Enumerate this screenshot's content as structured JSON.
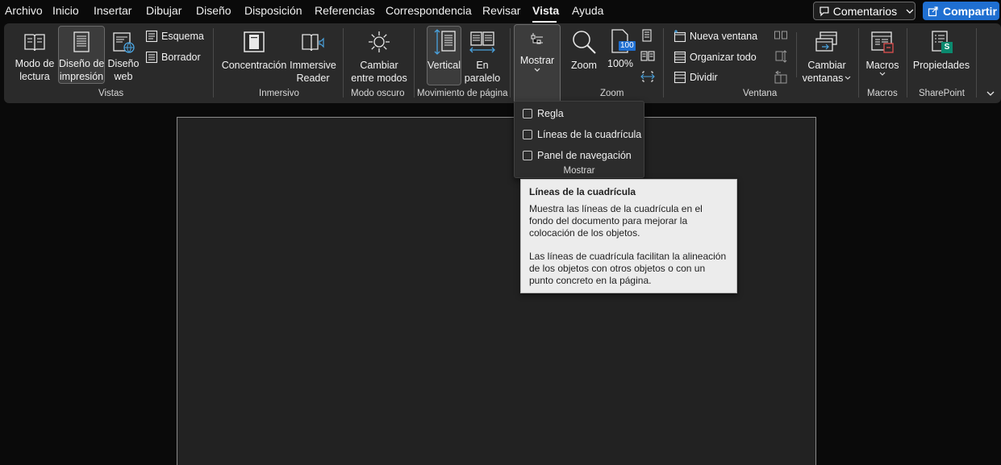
{
  "menu": {
    "items": [
      "Archivo",
      "Inicio",
      "Insertar",
      "Dibujar",
      "Diseño",
      "Disposición",
      "Referencias",
      "Correspondencia",
      "Revisar",
      "Vista",
      "Ayuda"
    ],
    "active": "Vista",
    "comments_label": "Comentarios",
    "share_label": "Compartir"
  },
  "ribbon": {
    "vistas": {
      "label": "Vistas",
      "reading_mode": [
        "Modo de",
        "lectura"
      ],
      "print_layout": [
        "Diseño de",
        "impresión"
      ],
      "web_layout": [
        "Diseño",
        "web"
      ],
      "outline": "Esquema",
      "draft": "Borrador"
    },
    "inmersivo": {
      "label": "Inmersivo",
      "focus": "Concentración",
      "immersive_reader": [
        "Immersive",
        "Reader"
      ]
    },
    "modo_oscuro": {
      "label": "Modo oscuro",
      "switch_modes": [
        "Cambiar",
        "entre modos"
      ]
    },
    "movimiento": {
      "label": "Movimiento de página",
      "vertical": "Vertical",
      "side_by_side": [
        "En",
        "paralelo"
      ]
    },
    "mostrar": {
      "label": "Mostrar"
    },
    "zoom": {
      "label": "Zoom",
      "zoom": "Zoom",
      "hundred": "100%",
      "hundred_badge": "100"
    },
    "ventana": {
      "label": "Ventana",
      "new_window": "Nueva ventana",
      "arrange_all": "Organizar todo",
      "split": "Dividir",
      "switch_windows": [
        "Cambiar",
        "ventanas"
      ]
    },
    "macros": {
      "label": "Macros",
      "macros": "Macros"
    },
    "sharepoint": {
      "label": "SharePoint",
      "properties": "Propiedades",
      "badge": "S"
    }
  },
  "dropdown": {
    "items": [
      {
        "label": "Regla",
        "checked": false
      },
      {
        "label": "Líneas de la cuadrícula",
        "checked": false
      },
      {
        "label": "Panel de navegación",
        "checked": false
      }
    ],
    "footer": "Mostrar"
  },
  "tooltip": {
    "title": "Líneas de la cuadrícula",
    "para1": "Muestra las líneas de la cuadrícula en el fondo del documento para mejorar la colocación de los objetos.",
    "para2": "Las líneas de cuadrícula facilitan la alineación de los objetos con otros objetos o con un punto concreto en la página."
  },
  "colors": {
    "accent_blue": "#1f6fd1",
    "icon_blue": "#4aa3df",
    "sharepoint_green": "#0b8a6f",
    "macro_red": "#e05050"
  }
}
